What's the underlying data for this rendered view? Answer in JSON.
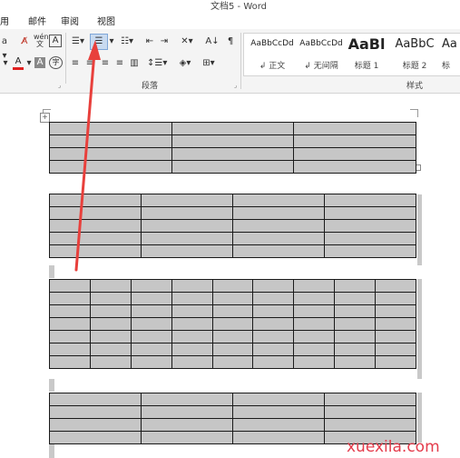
{
  "window": {
    "title": "文档5 - Word"
  },
  "menu": {
    "items": [
      "用",
      "邮件",
      "审阅",
      "视图"
    ]
  },
  "ribbon": {
    "groups": {
      "paragraph": "段落",
      "styles": "样式"
    },
    "styles": [
      {
        "sample": "AaBbCcDd",
        "name": "↲ 正文"
      },
      {
        "sample": "AaBbCcDd",
        "name": "↲ 无间隔"
      },
      {
        "sample": "AaBl",
        "name": "标题 1"
      },
      {
        "sample": "AaBbC",
        "name": "标题 2"
      },
      {
        "sample": "Aa",
        "name": "标"
      }
    ]
  },
  "document": {
    "tables": [
      {
        "rows": 4,
        "cols": 3
      },
      {
        "rows": 5,
        "cols": 4
      },
      {
        "rows": 7,
        "cols": 9
      },
      {
        "rows": 4,
        "cols": 4
      }
    ]
  },
  "colors": {
    "arrow": "#e8403c",
    "cell_shade": "#c6c6c6",
    "watermark": "#e43c4c"
  },
  "watermark": {
    "text": "xuexila.com"
  }
}
